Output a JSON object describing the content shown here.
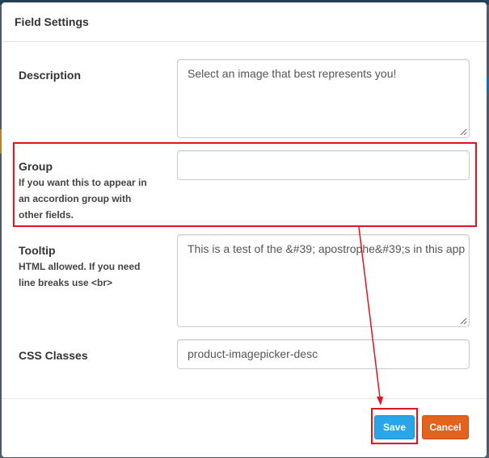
{
  "modal": {
    "title": "Field Settings"
  },
  "fields": {
    "description": {
      "label": "Description",
      "value": "Select an image that best represents you!"
    },
    "group": {
      "label": "Group",
      "help": [
        "If you want this to appear in",
        "an accordion group with",
        "other fields."
      ],
      "value": ""
    },
    "tooltip": {
      "label": "Tooltip",
      "help": [
        "HTML allowed. If you need",
        "line breaks use <br>"
      ],
      "value": "This is a test of the &#39; apostrophe&#39;s in this app"
    },
    "css_classes": {
      "label": "CSS Classes",
      "value": "product-imagepicker-desc"
    }
  },
  "footer": {
    "save_label": "Save",
    "cancel_label": "Cancel"
  },
  "colors": {
    "annotation_red": "#e0141e",
    "save_blue": "#2aa5e8",
    "cancel_orange": "#e3631d"
  }
}
